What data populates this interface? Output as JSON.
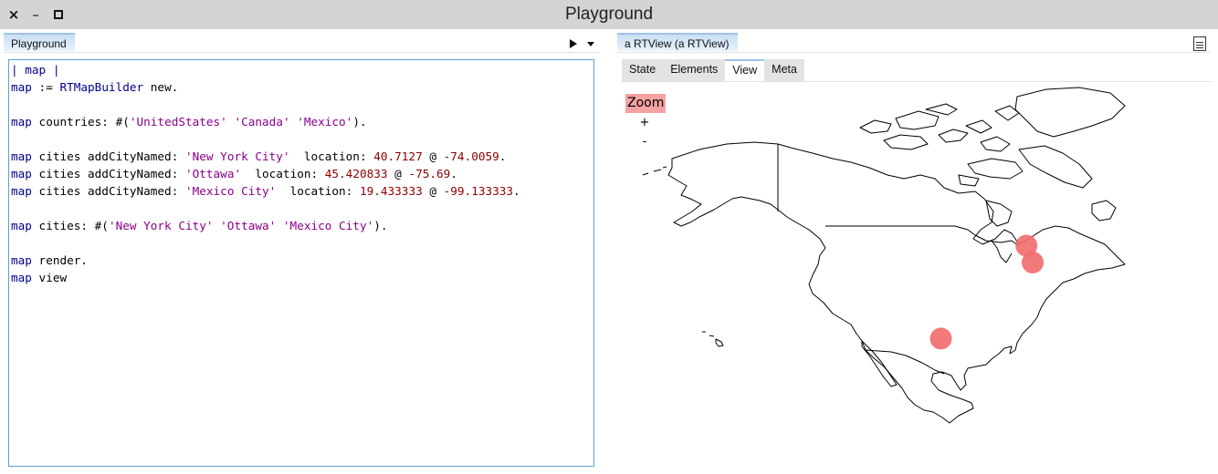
{
  "window": {
    "title": "Playground",
    "close_glyph": "×",
    "minimize_glyph": "–"
  },
  "left_panel": {
    "tab_label": "Playground",
    "play_icon": "play-icon",
    "dropdown_icon": "chevron-down-icon",
    "code_lines": [
      [
        {
          "t": "| map |",
          "k": "var"
        }
      ],
      [
        {
          "t": "map",
          "k": "var"
        },
        {
          "t": " := ",
          "k": "plain"
        },
        {
          "t": "RTMapBuilder",
          "k": "class"
        },
        {
          "t": " new.",
          "k": "plain"
        }
      ],
      [],
      [
        {
          "t": "map",
          "k": "var"
        },
        {
          "t": " countries: #(",
          "k": "plain"
        },
        {
          "t": "'UnitedStates'",
          "k": "str"
        },
        {
          "t": " ",
          "k": "plain"
        },
        {
          "t": "'Canada'",
          "k": "str"
        },
        {
          "t": " ",
          "k": "plain"
        },
        {
          "t": "'Mexico'",
          "k": "str"
        },
        {
          "t": ").",
          "k": "plain"
        }
      ],
      [],
      [
        {
          "t": "map",
          "k": "var"
        },
        {
          "t": " cities addCityNamed: ",
          "k": "plain"
        },
        {
          "t": "'New York City'",
          "k": "str"
        },
        {
          "t": "  location: ",
          "k": "plain"
        },
        {
          "t": "40.7127",
          "k": "num"
        },
        {
          "t": " @ ",
          "k": "plain"
        },
        {
          "t": "-74.0059",
          "k": "num"
        },
        {
          "t": ".",
          "k": "plain"
        }
      ],
      [
        {
          "t": "map",
          "k": "var"
        },
        {
          "t": " cities addCityNamed: ",
          "k": "plain"
        },
        {
          "t": "'Ottawa'",
          "k": "str"
        },
        {
          "t": "  location: ",
          "k": "plain"
        },
        {
          "t": "45.420833",
          "k": "num"
        },
        {
          "t": " @ ",
          "k": "plain"
        },
        {
          "t": "-75.69",
          "k": "num"
        },
        {
          "t": ".",
          "k": "plain"
        }
      ],
      [
        {
          "t": "map",
          "k": "var"
        },
        {
          "t": " cities addCityNamed: ",
          "k": "plain"
        },
        {
          "t": "'Mexico City'",
          "k": "str"
        },
        {
          "t": "  location: ",
          "k": "plain"
        },
        {
          "t": "19.433333",
          "k": "num"
        },
        {
          "t": " @ ",
          "k": "plain"
        },
        {
          "t": "-99.133333",
          "k": "num"
        },
        {
          "t": ".",
          "k": "plain"
        }
      ],
      [],
      [
        {
          "t": "map",
          "k": "var"
        },
        {
          "t": " cities: #(",
          "k": "plain"
        },
        {
          "t": "'New York City'",
          "k": "str"
        },
        {
          "t": " ",
          "k": "plain"
        },
        {
          "t": "'Ottawa'",
          "k": "str"
        },
        {
          "t": " ",
          "k": "plain"
        },
        {
          "t": "'Mexico City'",
          "k": "str"
        },
        {
          "t": ").",
          "k": "plain"
        }
      ],
      [],
      [
        {
          "t": "map",
          "k": "var"
        },
        {
          "t": " render.",
          "k": "plain"
        }
      ],
      [
        {
          "t": "map",
          "k": "var"
        },
        {
          "t": " view",
          "k": "plain"
        }
      ]
    ]
  },
  "right_panel": {
    "tab_label": "a RTView (a RTView)",
    "doc_icon": "document-icon",
    "inner_tabs": [
      {
        "label": "State",
        "active": false
      },
      {
        "label": "Elements",
        "active": false
      },
      {
        "label": "View",
        "active": true
      },
      {
        "label": "Meta",
        "active": false
      }
    ],
    "zoom": {
      "label": "Zoom",
      "plus": "+",
      "minus": "-"
    },
    "map": {
      "countries": [
        "UnitedStates",
        "Canada",
        "Mexico"
      ],
      "cities": [
        {
          "name": "New York City",
          "lat": 40.7127,
          "lon": -74.0059
        },
        {
          "name": "Ottawa",
          "lat": 45.420833,
          "lon": -75.69
        },
        {
          "name": "Mexico City",
          "lat": 19.433333,
          "lon": -99.133333
        }
      ],
      "city_color": "#f26b6b",
      "stroke_color": "#000000"
    }
  },
  "colors": {
    "titlebar": "#d4d4d4",
    "editor_border": "#5e9fd0",
    "tab_accent": "#9fc3ea",
    "zoom_bg": "#f5a2a2",
    "code_variable": "#00008b",
    "code_string": "#8b008b",
    "code_number": "#8b0000"
  }
}
